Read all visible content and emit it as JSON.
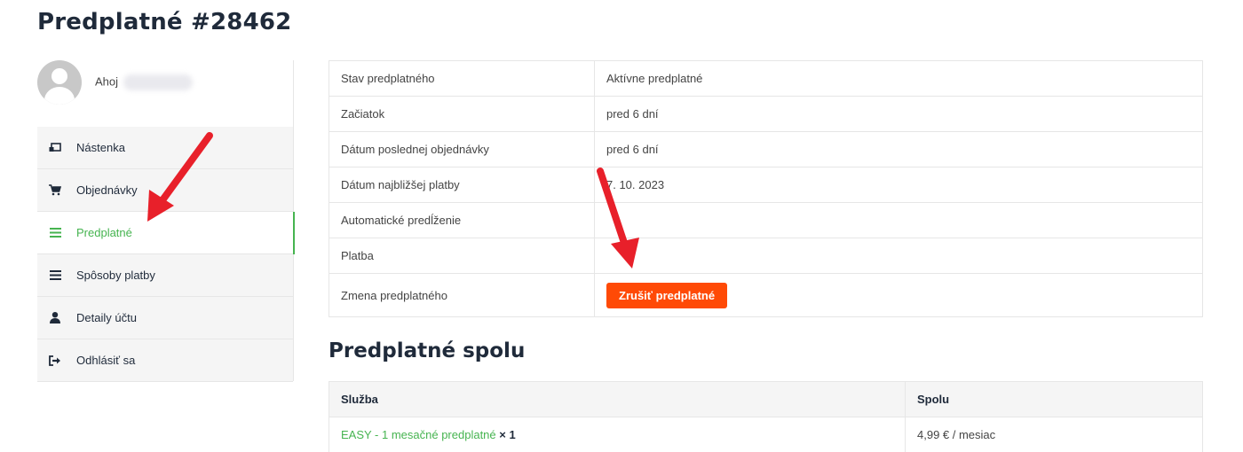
{
  "page": {
    "title": "Predplatné #28462"
  },
  "user": {
    "greeting": "Ahoj"
  },
  "sidebar": {
    "items": [
      {
        "label": "Nástenka",
        "icon": "dashboard-icon",
        "active": false
      },
      {
        "label": "Objednávky",
        "icon": "cart-icon",
        "active": false
      },
      {
        "label": "Predplatné",
        "icon": "list-icon",
        "active": true
      },
      {
        "label": "Spôsoby platby",
        "icon": "list-icon",
        "active": false
      },
      {
        "label": "Detaily účtu",
        "icon": "user-icon",
        "active": false
      },
      {
        "label": "Odhlásiť sa",
        "icon": "logout-icon",
        "active": false
      }
    ]
  },
  "subscription": {
    "rows": [
      {
        "label": "Stav predplatného",
        "value": "Aktívne predplatné"
      },
      {
        "label": "Začiatok",
        "value": "pred 6 dní"
      },
      {
        "label": "Dátum poslednej objednávky",
        "value": "pred 6 dní"
      },
      {
        "label": "Dátum najbližšej platby",
        "value": "7. 10. 2023"
      },
      {
        "label": "Automatické predĺženie",
        "value": ""
      },
      {
        "label": "Platba",
        "value": ""
      }
    ],
    "change_label": "Zmena predplatného",
    "cancel_button": "Zrušiť predplatné"
  },
  "totals": {
    "title": "Predplatné spolu",
    "headers": {
      "service": "Služba",
      "total": "Spolu"
    },
    "rows": [
      {
        "product": "EASY - 1 mesačné predplatné",
        "qty": "× 1",
        "total": "4,99 € / mesiac"
      }
    ]
  },
  "colors": {
    "accent": "#46b450",
    "cancel": "#ff4a06",
    "arrow": "#e8202a",
    "heading": "#1f2a3a"
  }
}
